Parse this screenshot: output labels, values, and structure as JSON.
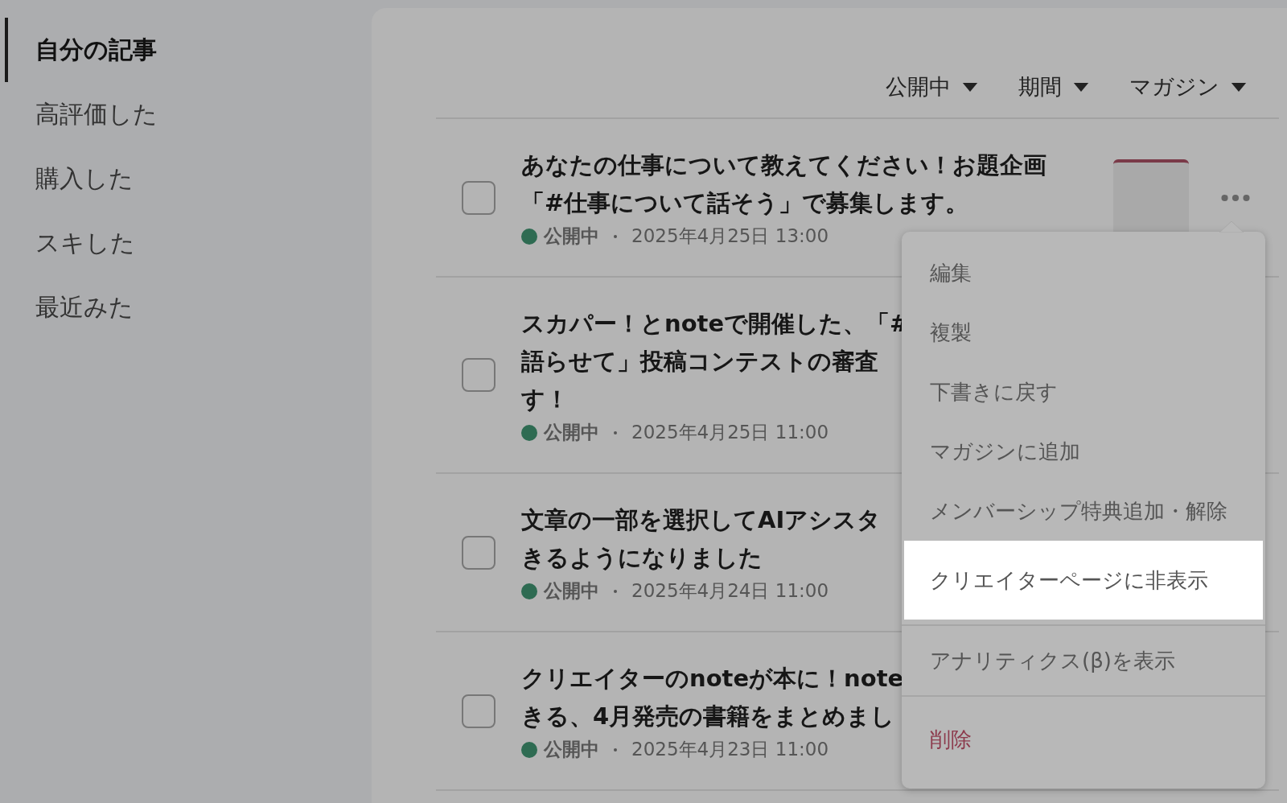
{
  "sidebar": {
    "items": [
      {
        "label": "自分の記事",
        "selected": true
      },
      {
        "label": "高評価した",
        "selected": false
      },
      {
        "label": "購入した",
        "selected": false
      },
      {
        "label": "スキした",
        "selected": false
      },
      {
        "label": "最近みた",
        "selected": false
      }
    ]
  },
  "filters": [
    "公開中",
    "期間",
    "マガジン"
  ],
  "articles": [
    {
      "title_lines": [
        "あなたの仕事について教えてください！お題企画",
        "「#仕事について話そう」で募集します。"
      ],
      "checked": false,
      "status": "公開中",
      "color": "#2e6b52",
      "date": "2025年4月25日 13:00",
      "thumbnail": true,
      "more_button": true
    },
    {
      "title_lines": [
        "スカパー！とnoteで開催した、「#",
        "語らせて」投稿コンテストの審査",
        "す！"
      ],
      "checked": false,
      "status": "公開中",
      "color": "#2e6b52",
      "date": "2025年4月25日 11:00"
    },
    {
      "title_lines": [
        "文章の一部を選択してAIアシスタ",
        "きるようになりました"
      ],
      "checked": false,
      "status": "公開中",
      "color": "#2e6b52",
      "date": "2025年4月24日 11:00"
    },
    {
      "title_lines": [
        "クリエイターのnoteが本に！note",
        "きる、4月発売の書籍をまとめまし"
      ],
      "checked": false,
      "status": "公開中",
      "color": "#2e6b52",
      "date": "2025年4月23日 11:00"
    }
  ],
  "menu": {
    "groups": [
      [
        {
          "label": "編集",
          "kind": "normal",
          "selected": false
        },
        {
          "label": "複製",
          "kind": "normal",
          "selected": false
        },
        {
          "label": "下書きに戻す",
          "kind": "normal",
          "selected": false
        },
        {
          "label": "マガジンに追加",
          "kind": "normal",
          "selected": false
        },
        {
          "label": "メンバーシップ特典追加・解除",
          "kind": "normal",
          "selected": false
        },
        {
          "label": "クリエイターページに非表示",
          "kind": "normal",
          "selected": true
        }
      ],
      [
        {
          "label": "アナリティクス(β)を表示",
          "kind": "normal",
          "selected": false
        }
      ],
      [
        {
          "label": "削除",
          "kind": "danger",
          "selected": false
        }
      ]
    ]
  }
}
